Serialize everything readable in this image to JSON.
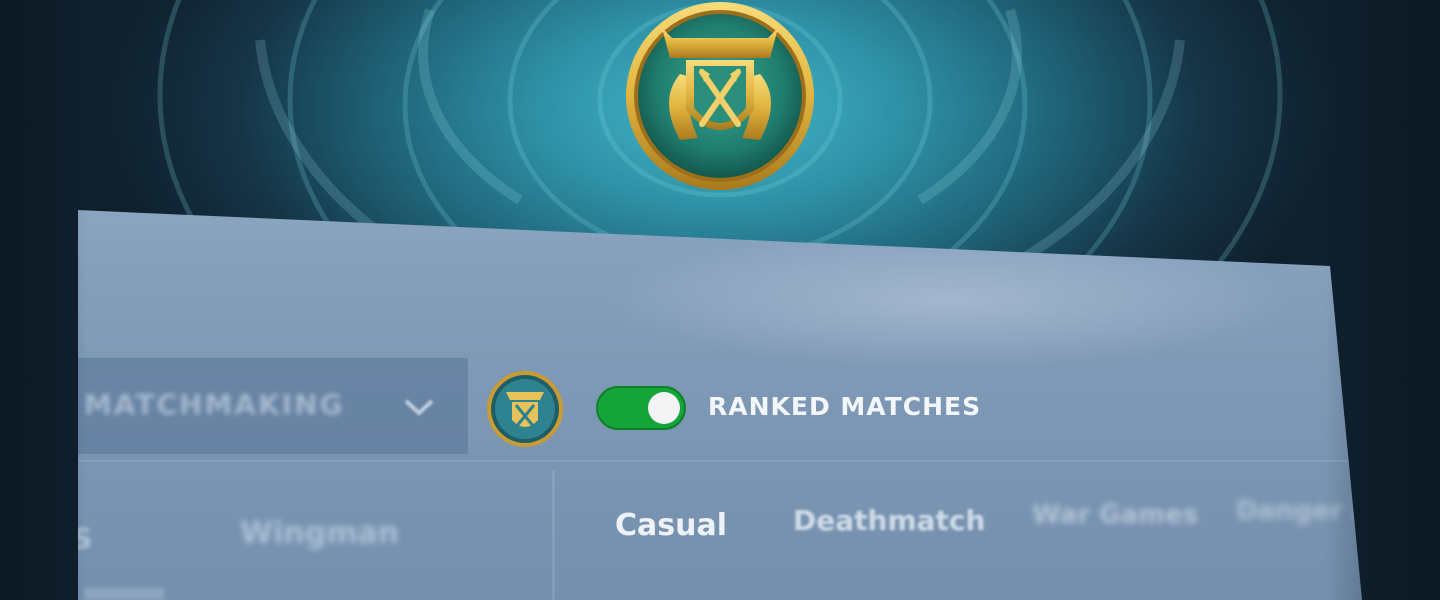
{
  "matchmaking": {
    "dropdown_value": "MATCHMAKING",
    "ranked_toggle": {
      "label": "RANKED MATCHES",
      "on": true
    }
  },
  "tabs": [
    {
      "label": "S"
    },
    {
      "label": "Wingman"
    },
    {
      "label": "Casual",
      "active": true
    },
    {
      "label": "Deathmatch"
    },
    {
      "label": "War Games"
    },
    {
      "label": "Danger Zone"
    }
  ],
  "colors": {
    "toggle_on": "#15a43a",
    "emblem_gold": "#e0b43e",
    "emblem_teal": "#1f8f7e"
  },
  "icons": [
    "rank-emblem-icon",
    "chevron-down-icon",
    "toggle-switch"
  ]
}
